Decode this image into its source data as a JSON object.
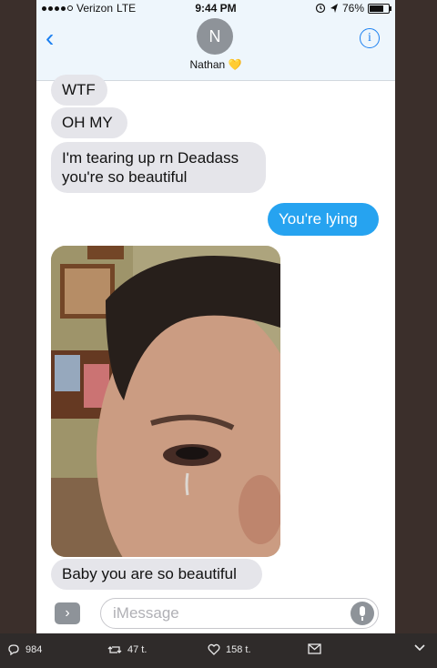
{
  "status": {
    "carrier": "Verizon",
    "network": "LTE",
    "time": "9:44 PM",
    "battery": "76%"
  },
  "nav": {
    "back_icon": "‹",
    "avatar_letter": "N",
    "contact_name": "Nathan",
    "heart": "💛",
    "info_icon": "i"
  },
  "messages": [
    {
      "text": "WTF",
      "from": "them"
    },
    {
      "text": "OH MY",
      "from": "them"
    },
    {
      "text": "I'm tearing up rn Deadass you're so beautiful",
      "from": "them"
    },
    {
      "text": "You're lying",
      "from": "me"
    },
    {
      "text": "Baby you are so beautiful",
      "from": "them"
    }
  ],
  "input": {
    "placeholder": "iMessage",
    "apps_icon": "›"
  },
  "tweet": {
    "replies": "984",
    "retweets": "47 t.",
    "likes": "158 t."
  },
  "colors": {
    "accent": "#1a7ff0",
    "sent_bubble": "#26a3f0",
    "received_bubble": "#e5e5ea"
  }
}
